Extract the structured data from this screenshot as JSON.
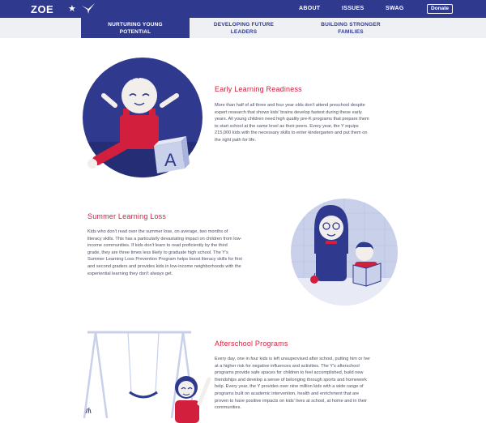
{
  "header": {
    "logo_text": "ZOE",
    "logo_star": "★",
    "nav": [
      {
        "label": "ABOUT"
      },
      {
        "label": "ISSUES"
      },
      {
        "label": "SWAG"
      }
    ],
    "donate_label": "Donate"
  },
  "subnav": {
    "tabs": [
      {
        "line1": "NURTURING YOUNG",
        "line2": "POTENTIAL",
        "active": true
      },
      {
        "line1": "DEVELOPING FUTURE",
        "line2": "LEADERS",
        "active": false
      },
      {
        "line1": "BUILDING STRONGER",
        "line2": "FAMILIES",
        "active": false
      }
    ]
  },
  "sections": [
    {
      "title": "Early Learning Readiness",
      "lines": [
        "More than half of all three and four year olds don't attend preschool despite",
        "expert research that shows kids' brains develop fastest during these early",
        "years. All young children need high quality pre-K programs that prepare them",
        "to start school at the same level as their peers. Every year, the Y equips",
        "215,000 kids with the necessary skills to enter kindergarten and put them on",
        "the right path for life."
      ],
      "block_letter": "A"
    },
    {
      "title": "Summer Learning Loss",
      "lines": [
        "Kids who don't read over the summer lose, on average, two months of",
        "literacy skills. This has a particularly devastating impact on children from low-",
        "income communities. If kids don't learn to read proficiently by the third",
        "grade, they are three times less likely to graduate high school. The Y's",
        "Summer Learning Loss Prevention Program helps boost literacy skills for first",
        "and second graders and provides kids in low-income neighborhoods with the",
        "experiential learning they don't always get."
      ]
    },
    {
      "title": "Afterschool Programs",
      "lines": [
        "Every day, one in four kids is left unsupervised after school, putting him or her",
        "at a higher risk for negative influences and activities. The Y's afterschool",
        "programs provide safe spaces for children to feel accomplished, build new",
        "friendships and develop a sense of belonging through sports and homework",
        "help. Every year, the Y provides over nine million kids with a wide range of",
        "programs built on academic intervention, health and enrichment that are",
        "proven to have positive impacts on kids' lives at school, at home and in their",
        "communities."
      ]
    }
  ],
  "colors": {
    "navy": "#2f3a8f",
    "red": "#d31f3e",
    "skin": "#f2eeec",
    "light_blue": "#c9d0ea"
  }
}
